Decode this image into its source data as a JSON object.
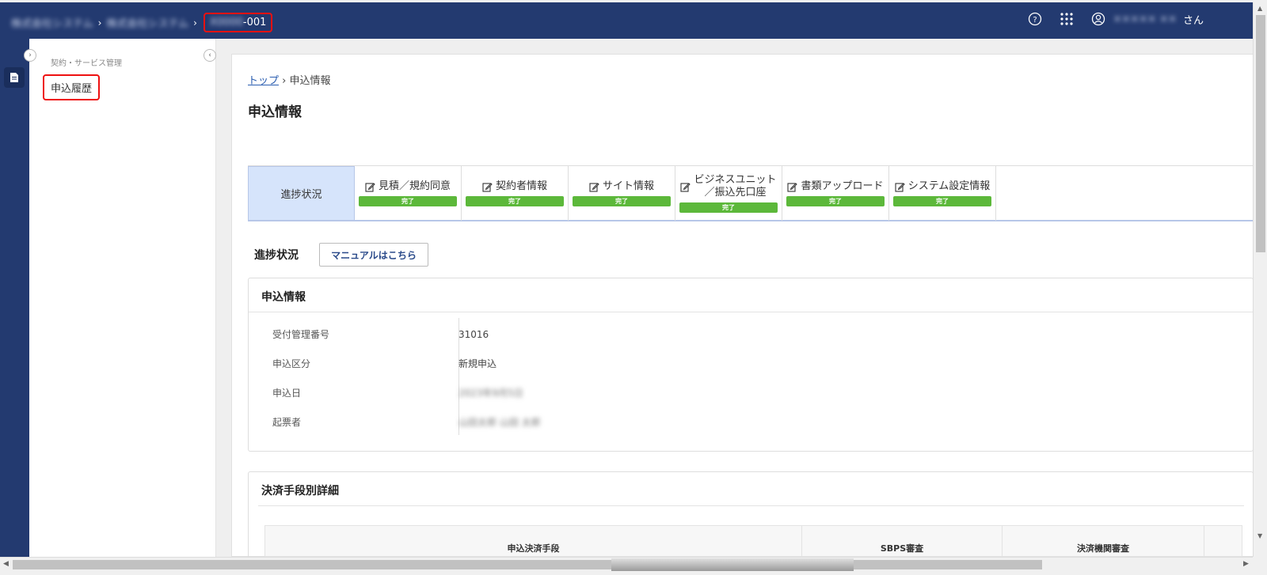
{
  "header": {
    "crumb1": "株式会社システム",
    "crumb2": "株式会社システム",
    "crumb3_prefix": "X0000",
    "crumb3_suffix": "-001",
    "separator": "›",
    "user_name": "××××× ××",
    "user_suffix": "さん",
    "icons": [
      "help-icon",
      "apps-grid-icon",
      "user-icon"
    ]
  },
  "sidebar": {
    "section_label": "契約・サービス管理",
    "item_label": "申込履歴"
  },
  "breadcrumb": {
    "top_link": "トップ",
    "separator": "›",
    "current": "申込情報"
  },
  "page_title": "申込情報",
  "steps": {
    "active_label": "進捗状況",
    "items": [
      {
        "label": "見積／規約同意",
        "status": "完了"
      },
      {
        "label": "契約者情報",
        "status": "完了"
      },
      {
        "label": "サイト情報",
        "status": "完了"
      },
      {
        "label_line1": "ビジネスユニット",
        "label_line2": "／振込先口座",
        "status": "完了"
      },
      {
        "label": "書類アップロード",
        "status": "完了"
      },
      {
        "label": "システム設定情報",
        "status": "完了"
      }
    ]
  },
  "progress": {
    "title": "進捗状況",
    "manual_button": "マニュアルはこちら"
  },
  "application_info": {
    "title": "申込情報",
    "rows": [
      {
        "label": "受付管理番号",
        "value": "31016"
      },
      {
        "label": "申込区分",
        "value": "新規申込"
      },
      {
        "label": "申込日",
        "value": "2023年9月5日"
      },
      {
        "label": "起票者",
        "value": "山田太郎 山田 太郎"
      }
    ]
  },
  "payment_details": {
    "title": "決済手段別詳細",
    "columns": [
      "申込決済手段",
      "SBPS審査",
      "決済機関審査"
    ]
  }
}
